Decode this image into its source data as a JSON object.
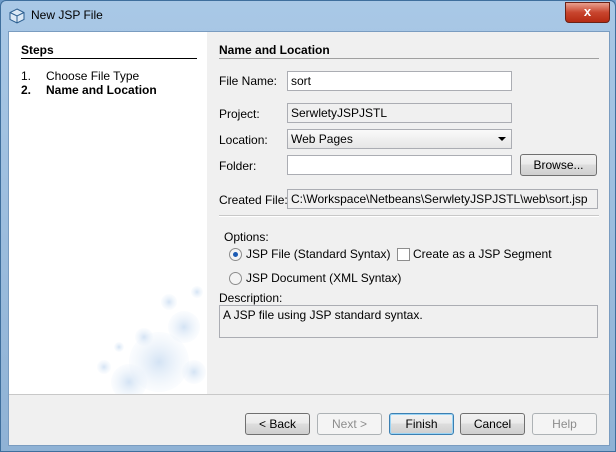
{
  "window": {
    "title": "New JSP File",
    "close_label": "x"
  },
  "steps": {
    "heading": "Steps",
    "items": [
      {
        "num": "1.",
        "label": "Choose File Type",
        "current": false
      },
      {
        "num": "2.",
        "label": "Name and Location",
        "current": true
      }
    ]
  },
  "main": {
    "heading": "Name and Location",
    "file_name": {
      "label": "File Name:",
      "value": "sort"
    },
    "project": {
      "label": "Project:",
      "value": "SerwletyJSPJSTL"
    },
    "location": {
      "label": "Location:",
      "value": "Web Pages"
    },
    "folder": {
      "label": "Folder:",
      "value": "",
      "browse_label": "Browse..."
    },
    "created_file": {
      "label": "Created File:",
      "value": "C:\\Workspace\\Netbeans\\SerwletyJSPJSTL\\web\\sort.jsp"
    },
    "options": {
      "label": "Options:",
      "jsp_file_label": "JSP File (Standard Syntax)",
      "jsp_document_label": "JSP Document (XML Syntax)",
      "segment_label": "Create as a JSP Segment",
      "selected": "jsp_file",
      "segment_checked": false
    },
    "description": {
      "label": "Description:",
      "text": "A JSP file using JSP standard syntax."
    }
  },
  "buttons": {
    "back": "< Back",
    "next": "Next >",
    "finish": "Finish",
    "cancel": "Cancel",
    "help": "Help"
  },
  "icons": {
    "app": "netbeans-cube-icon",
    "close": "close-icon",
    "dropdown": "chevron-down-icon"
  },
  "colors": {
    "accent": "#3c7fb1",
    "title_bar": "#a9c8e6",
    "close": "#c8452e"
  }
}
